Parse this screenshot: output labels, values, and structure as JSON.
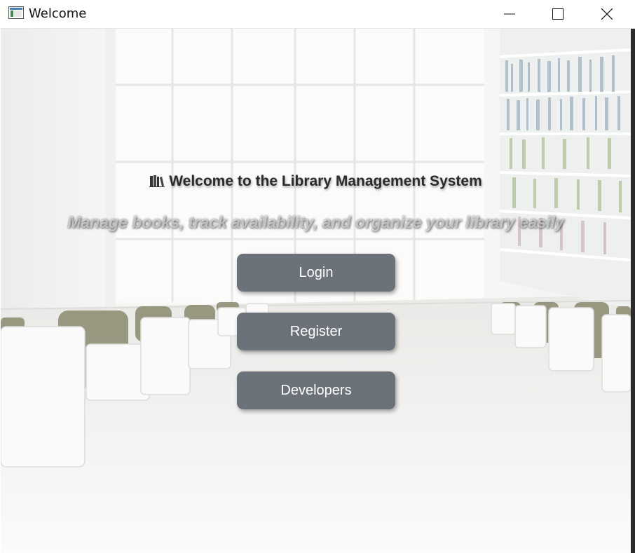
{
  "window": {
    "title": "Welcome",
    "controls": {
      "minimize": "minimize-icon",
      "maximize": "maximize-icon",
      "close": "close-icon"
    }
  },
  "main": {
    "heading_icon": "books-icon",
    "heading": "Welcome to the Library Management System",
    "subtitle": "Manage books, track availability, and organize your library easily",
    "buttons": {
      "login": "Login",
      "register": "Register",
      "developers": "Developers"
    }
  },
  "colors": {
    "button_bg": "#6c727a",
    "button_text": "#ffffff",
    "heading_text": "#2a2a2a"
  }
}
